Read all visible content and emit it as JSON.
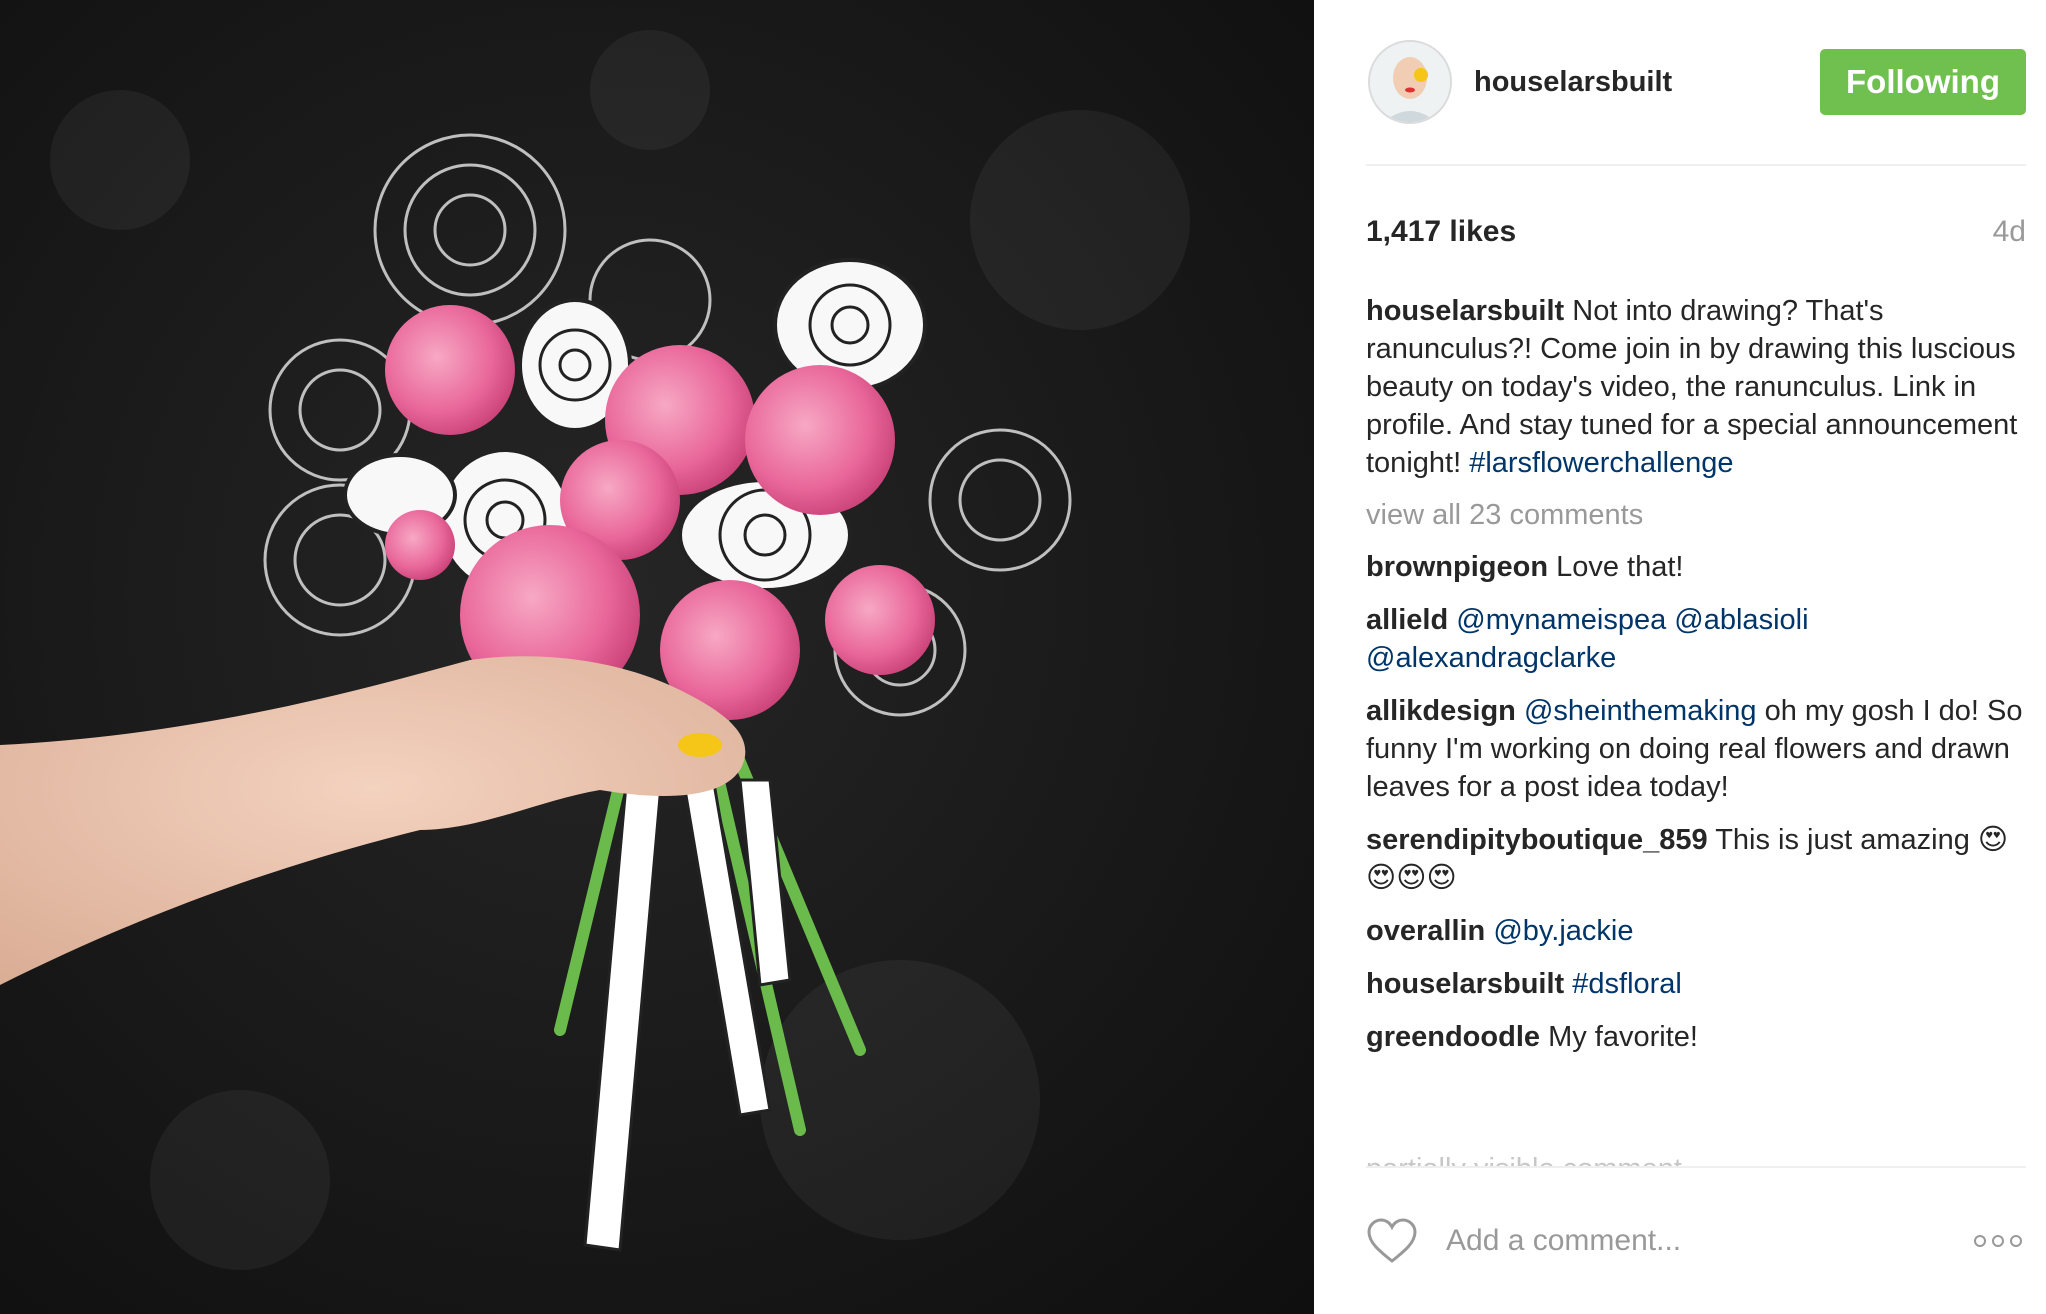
{
  "post": {
    "image_alt": "Hand holding bouquet of pink ranunculus with drawn flowers on chalkboard",
    "author": "houselarsbuilt",
    "follow_label": "Following",
    "likes": "1,417 likes",
    "age": "4d",
    "caption": {
      "user": "houselarsbuilt",
      "text": "Not into drawing? That's ranunculus?! Come join in by drawing this luscious beauty on today's video, the ranunculus. Link in profile. And stay tuned for a special announcement tonight! ",
      "hashtag": "#larsflowerchallenge"
    },
    "view_all": "view all 23 comments",
    "comments": [
      {
        "user": "brownpigeon",
        "text": "Love that!"
      },
      {
        "user": "allield",
        "mention1": "@mynameispea",
        "mention2": "@ablasioli",
        "mention3": "@alexandragclarke"
      },
      {
        "user": "allikdesign",
        "mention": "@sheinthemaking",
        "text": "oh my gosh I do! So funny I'm working on doing real flowers and drawn leaves for a post idea today!"
      },
      {
        "user": "serendipityboutique_859",
        "text": "This is just amazing 😍😍😍😍"
      },
      {
        "user": "overallin",
        "mention": "@by.jackie"
      },
      {
        "user": "houselarsbuilt",
        "hashtag": "#dsfloral"
      },
      {
        "user": "greendoodle",
        "text": "My favorite!"
      }
    ],
    "partial_comment": "partially visible comment"
  },
  "footer": {
    "comment_placeholder": "Add a comment..."
  },
  "icons": {
    "like": "heart-icon",
    "more": "more-options-icon"
  }
}
